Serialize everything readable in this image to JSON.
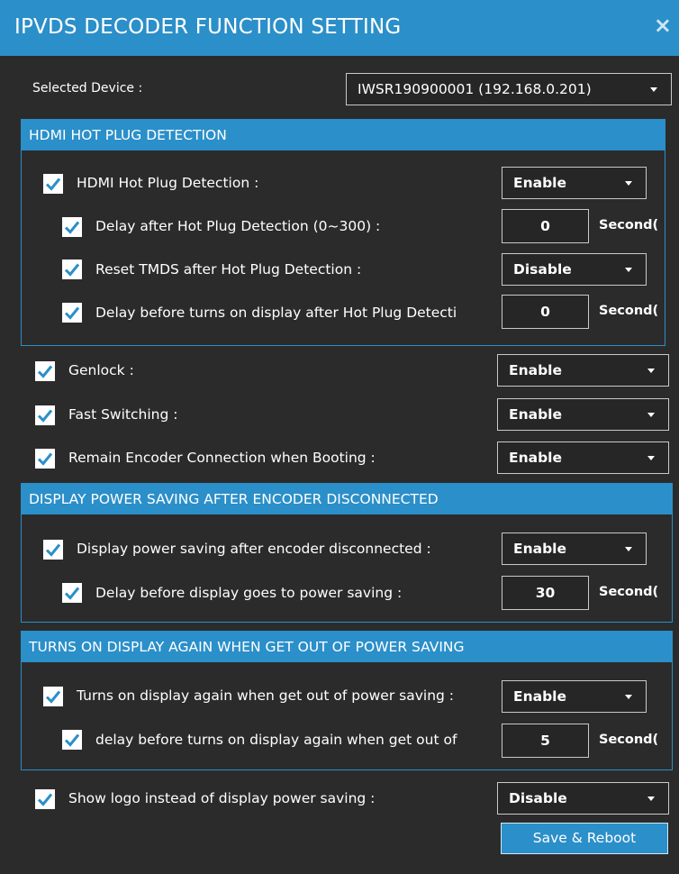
{
  "window": {
    "title": "IPVDS DECODER FUNCTION SETTING",
    "close_glyph": "×"
  },
  "device": {
    "label": "Selected Device :",
    "value": "IWSR190900001 (192.168.0.201)"
  },
  "hdmi": {
    "header": "HDMI HOT PLUG DETECTION",
    "detection": {
      "label": "HDMI Hot Plug Detection :",
      "checked": true,
      "value": "Enable"
    },
    "delay_after": {
      "label": "Delay after Hot Plug Detection (0~300) :",
      "checked": true,
      "value": "0",
      "unit": "Second("
    },
    "reset_tmds": {
      "label": "Reset TMDS after Hot Plug Detection :",
      "checked": true,
      "value": "Disable"
    },
    "delay_before": {
      "label": "Delay before turns on display after Hot Plug Detecti",
      "checked": true,
      "value": "0",
      "unit": "Second("
    }
  },
  "genlock": {
    "label": "Genlock :",
    "checked": true,
    "value": "Enable"
  },
  "fast_switching": {
    "label": "Fast Switching :",
    "checked": true,
    "value": "Enable"
  },
  "remain_encoder": {
    "label": "Remain Encoder Connection when Booting :",
    "checked": true,
    "value": "Enable"
  },
  "power_saving": {
    "header": "DISPLAY POWER SAVING AFTER ENCODER DISCONNECTED",
    "enable": {
      "label": "Display power saving after encoder disconnected :",
      "checked": true,
      "value": "Enable"
    },
    "delay": {
      "label": "Delay before display goes to power saving :",
      "checked": true,
      "value": "30",
      "unit": "Second("
    }
  },
  "turn_on": {
    "header": "TURNS ON DISPLAY AGAIN WHEN GET OUT OF POWER SAVING",
    "enable": {
      "label": "Turns on display again when get out of power saving :",
      "checked": true,
      "value": "Enable"
    },
    "delay": {
      "label": "delay before turns on display again when get out of",
      "checked": true,
      "value": "5",
      "unit": "Second("
    }
  },
  "show_logo": {
    "label": "Show logo instead of display power saving :",
    "checked": true,
    "value": "Disable"
  },
  "save_button": "Save & Reboot",
  "colors": {
    "accent": "#2b8fc9",
    "background": "#2b2b2b",
    "check": "#2b8fc9"
  },
  "icons": {
    "close": "close-icon",
    "check": "checkmark-icon",
    "dropdown": "chevron-down-icon"
  }
}
